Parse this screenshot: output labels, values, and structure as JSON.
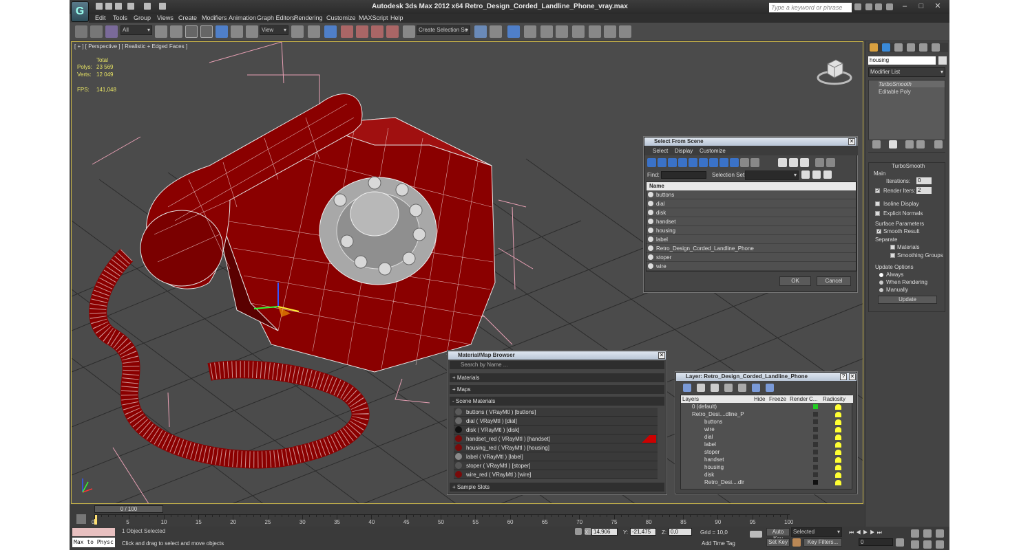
{
  "window": {
    "title": "Autodesk 3ds Max  2012 x64     Retro_Design_Corded_Landline_Phone_vray.max",
    "search_placeholder": "Type a keyword or phrase",
    "logo_glyph": "G"
  },
  "menu": [
    "Edit",
    "Tools",
    "Group",
    "Views",
    "Create",
    "Modifiers",
    "Animation",
    "Graph Editors",
    "Rendering",
    "Customize",
    "MAXScript",
    "Help"
  ],
  "toolbar": {
    "selection_filter": "All",
    "reference_coord": "View",
    "named_selection": "Create Selection Se"
  },
  "viewport": {
    "label": "[ + ] [ Perspective ] [ Realistic + Edged Faces ]",
    "stats": {
      "total_label": "Total",
      "polys_label": "Polys:",
      "polys_value": "23 569",
      "verts_label": "Verts:",
      "verts_value": "12 049",
      "fps_label": "FPS:",
      "fps_value": "141,048"
    }
  },
  "command_panel": {
    "object_name": "housing",
    "modifier_list": "Modifier List",
    "stack": [
      "TurboSmooth",
      "Editable Poly"
    ],
    "rollout_title": "TurboSmooth",
    "main_label": "Main",
    "iterations_label": "Iterations:",
    "iterations_value": "0",
    "render_iters_label": "Render Iters:",
    "render_iters_value": "2",
    "isoline": "Isoline Display",
    "explicit_normals": "Explicit Normals",
    "surface_params": "Surface Parameters",
    "smooth_result": "Smooth Result",
    "separate": "Separate",
    "materials": "Materials",
    "smoothing_groups": "Smoothing Groups",
    "update_options": "Update Options",
    "always": "Always",
    "when_rendering": "When Rendering",
    "manually": "Manually",
    "update_button": "Update"
  },
  "select_from_scene": {
    "title": "Select From Scene",
    "menus": [
      "Select",
      "Display",
      "Customize"
    ],
    "find_label": "Find:",
    "selection_set_label": "Selection Set:",
    "column_name": "Name",
    "items": [
      "buttons",
      "dial",
      "disk",
      "handset",
      "housing",
      "label",
      "Retro_Design_Corded_Landline_Phone",
      "stoper",
      "wire"
    ],
    "ok": "OK",
    "cancel": "Cancel"
  },
  "material_browser": {
    "title": "Material/Map Browser",
    "search_placeholder": "Search by Name ...",
    "groups": [
      "+ Materials",
      "+ Maps",
      "- Scene Materials"
    ],
    "materials": [
      {
        "name": "buttons  ( VRayMtl ) [buttons]",
        "color": "#5a5a5a"
      },
      {
        "name": "dial  ( VRayMtl ) [dial]",
        "color": "#6a6a6a"
      },
      {
        "name": "disk  ( VRayMtl ) [disk]",
        "color": "#111111"
      },
      {
        "name": "handset_red  ( VRayMtl ) [handset]",
        "color": "#7a0a0a"
      },
      {
        "name": "housing_red  ( VRayMtl ) [housing]",
        "color": "#7a0a0a"
      },
      {
        "name": "label  ( VRayMtl ) [label]",
        "color": "#8a8a8a"
      },
      {
        "name": "stoper  ( VRayMtl ) [stoper]",
        "color": "#555555"
      },
      {
        "name": "wire_red  ( VRayMtl ) [wire]",
        "color": "#7a0a0a"
      }
    ],
    "sample_slots": "+ Sample Slots"
  },
  "layer_manager": {
    "title": "Layer: Retro_Design_Corded_Landline_Phone",
    "columns": [
      "Layers",
      "Hide",
      "Freeze",
      "Render",
      "C...",
      "Radiosity"
    ],
    "rows": [
      "0 (default)",
      "Retro_Desi....dline_P",
      "buttons",
      "wire",
      "dial",
      "label",
      "stoper",
      "handset",
      "housing",
      "disk",
      "Retro_Desi....dlr"
    ]
  },
  "timeline": {
    "frame_display": "0 / 100",
    "ticks": [
      "0",
      "5",
      "10",
      "15",
      "20",
      "25",
      "30",
      "35",
      "40",
      "45",
      "50",
      "55",
      "60",
      "65",
      "70",
      "75",
      "80",
      "85",
      "90",
      "95",
      "100"
    ]
  },
  "status": {
    "maxscript": "Max to Physc",
    "selected": "1 Object Selected",
    "prompt": "Click and drag to select and move objects",
    "x_label": "X:",
    "x_value": "14,906",
    "y_label": "Y:",
    "y_value": "-21,475",
    "z_label": "Z:",
    "z_value": "0,0",
    "grid": "Grid = 10,0",
    "add_time_tag": "Add Time Tag",
    "auto_key": "Auto Key",
    "selected_dd": "Selected",
    "set_key": "Set Key",
    "key_filters": "Key Filters...",
    "frame": "0"
  },
  "colors": {
    "accent_viewport_border": "#c8b44a",
    "stats_color": "#e8e464",
    "phone_red": "#8a0000"
  }
}
